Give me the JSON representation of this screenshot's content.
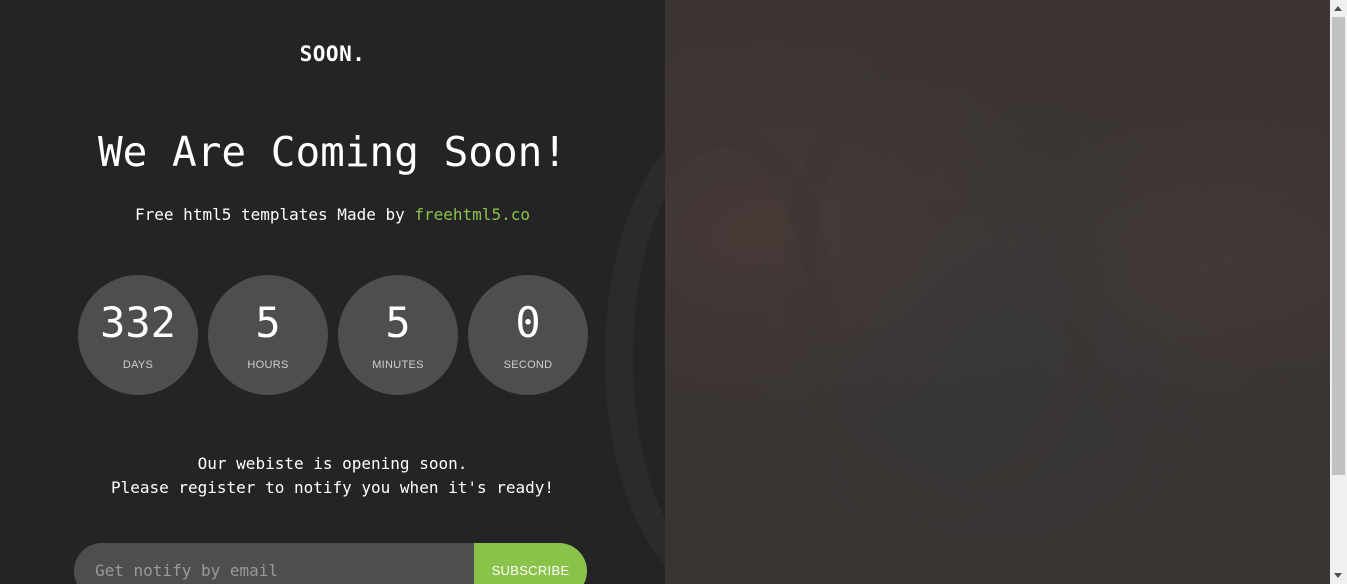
{
  "brand": {
    "logo": "SOON."
  },
  "hero": {
    "headline": "We Are Coming Soon!",
    "subtitle_prefix": "Free html5 templates Made by ",
    "subtitle_link": "freehtml5.co"
  },
  "countdown": [
    {
      "value": "332",
      "label": "DAYS"
    },
    {
      "value": "5",
      "label": "HOURS"
    },
    {
      "value": "5",
      "label": "MINUTES"
    },
    {
      "value": "0",
      "label": "SECOND"
    }
  ],
  "message": {
    "line1": "Our webiste is opening soon.",
    "line2": "Please register to notify you when it's ready!"
  },
  "subscribe": {
    "placeholder": "Get notify by email",
    "button_label": "SUBSCRIBE"
  },
  "colors": {
    "left_background": "#242427",
    "circle_background": "#4e4e50",
    "accent": "#8bc34a",
    "text": "#ffffff"
  }
}
